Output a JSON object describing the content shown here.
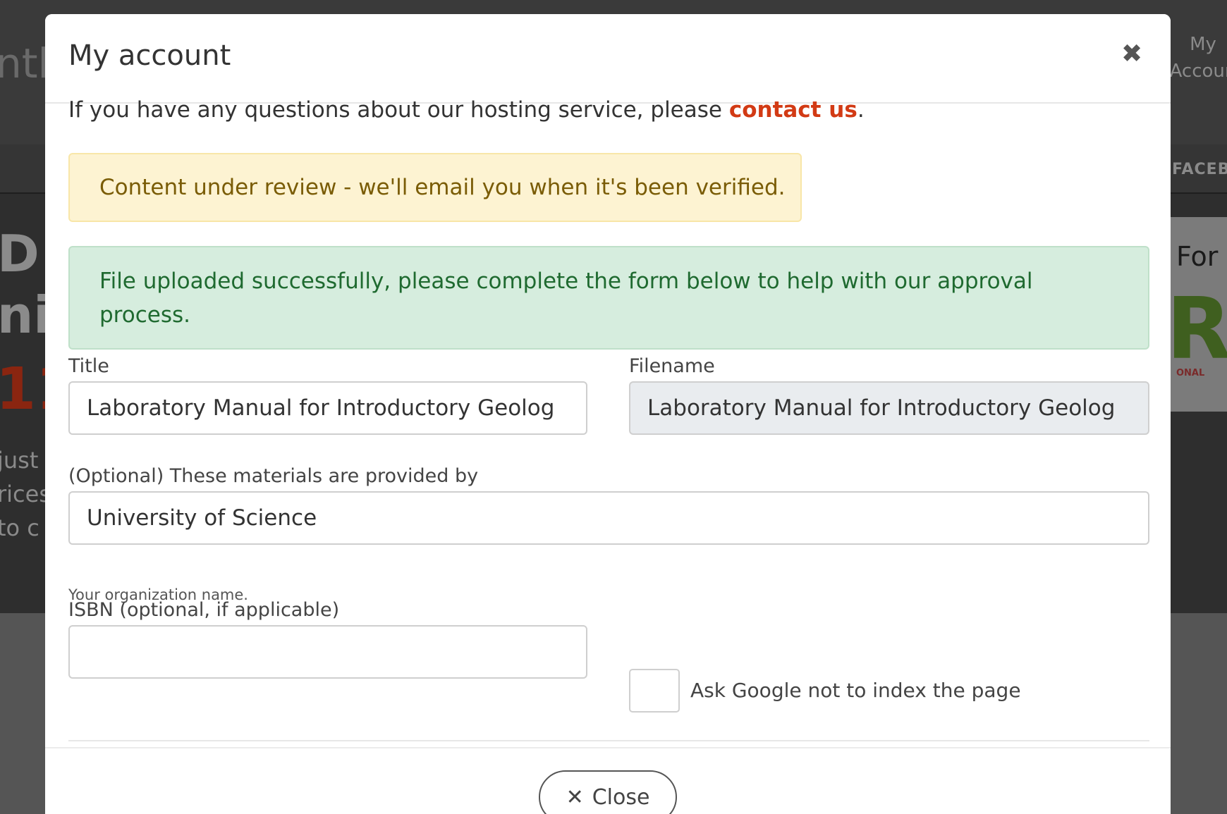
{
  "background": {
    "brand_fragment": "ntl",
    "nav_my_account": "My Accoun",
    "nav_facebook": "FACEB",
    "side_for": "For",
    "side_letter": "R",
    "side_tag": "ONAL",
    "hero_line1": "D",
    "hero_line2": "ni",
    "hero_number": "11",
    "text_line1": "just",
    "text_line2": "rices",
    "text_line3": "to c"
  },
  "modal": {
    "title": "My account",
    "close_glyph": "✖",
    "intro_text": "If you have any questions about our hosting service, please ",
    "intro_link": "contact us",
    "intro_end": ".",
    "alert_review": "Content under review - we'll email you when it's been verified.",
    "alert_success": "File uploaded successfully, please complete the form below to help with our approval process.",
    "form": {
      "title_label": "Title",
      "title_value": "Laboratory Manual for Introductory Geolog",
      "filename_label": "Filename",
      "filename_value": "Laboratory Manual for Introductory Geolog",
      "provider_label": "(Optional) These materials are provided by",
      "provider_value": "University of Science",
      "provider_help": "Your organization name.",
      "isbn_label": "ISBN (optional, if applicable)",
      "isbn_value": "",
      "noindex_label": "Ask Google not to index the page",
      "noindex_checked": false
    },
    "close_button_icon": "✕",
    "close_button_label": "Close"
  },
  "colors": {
    "link": "#d23a14",
    "warning_bg": "#fdf3d2",
    "warning_text": "#7a5c06",
    "success_bg": "#d6edde",
    "success_text": "#1f6a30",
    "readonly_bg": "#e9ecef"
  }
}
